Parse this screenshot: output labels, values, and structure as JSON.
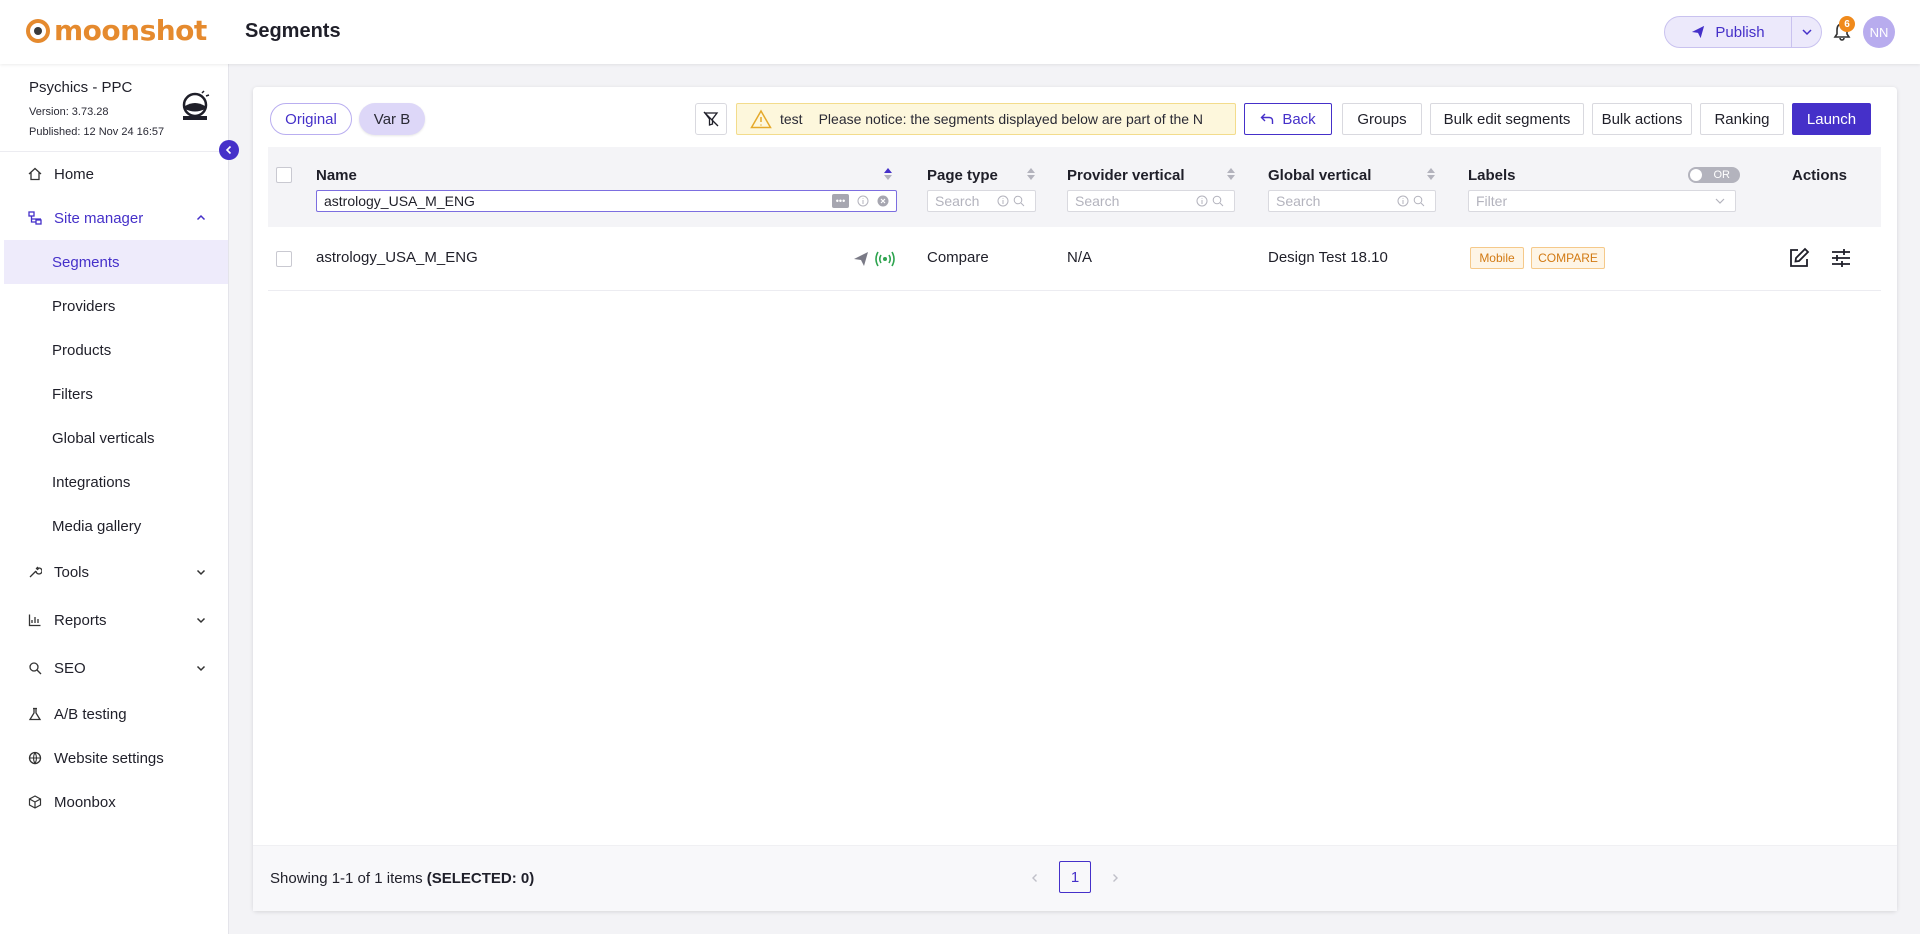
{
  "header": {
    "logo_text": "moonshot",
    "page_title": "Segments",
    "publish_label": "Publish",
    "notifications_count": "6",
    "avatar_initials": "NN"
  },
  "site": {
    "name": "Psychics - PPC",
    "version": "Version: 3.73.28",
    "published": "Published: 12 Nov 24 16:57"
  },
  "nav": {
    "home": "Home",
    "site_manager": "Site manager",
    "sub": [
      "Segments",
      "Providers",
      "Products",
      "Filters",
      "Global verticals",
      "Integrations",
      "Media gallery"
    ],
    "tools": "Tools",
    "reports": "Reports",
    "seo": "SEO",
    "ab_testing": "A/B testing",
    "website_settings": "Website settings",
    "moonbox": "Moonbox"
  },
  "toolbar": {
    "variant_original": "Original",
    "variant_b": "Var B",
    "notice_tag": "test",
    "notice_message": "Please notice: the segments displayed below are part of the N",
    "back": "Back",
    "groups": "Groups",
    "bulk_edit": "Bulk edit segments",
    "bulk_actions": "Bulk actions",
    "ranking": "Ranking",
    "launch": "Launch"
  },
  "table": {
    "columns": {
      "name": "Name",
      "page_type": "Page type",
      "provider_vertical": "Provider vertical",
      "global_vertical": "Global vertical",
      "labels": "Labels",
      "actions": "Actions"
    },
    "filters": {
      "name_value": "astrology_USA_M_ENG",
      "search_placeholder": "Search",
      "labels_placeholder": "Filter",
      "or_toggle": "OR"
    },
    "rows": [
      {
        "name": "astrology_USA_M_ENG",
        "page_type": "Compare",
        "provider_vertical": "N/A",
        "global_vertical": "Design Test 18.10",
        "labels": [
          "Mobile",
          "COMPARE"
        ]
      }
    ]
  },
  "footer": {
    "showing": "Showing 1-1 of 1 items",
    "selected": "(SELECTED: 0)",
    "current_page": "1"
  },
  "colors": {
    "accent": "#4530c9",
    "logo": "#e58a2e",
    "label_tag": "#d27a13",
    "status_green": "#2ea44f"
  }
}
